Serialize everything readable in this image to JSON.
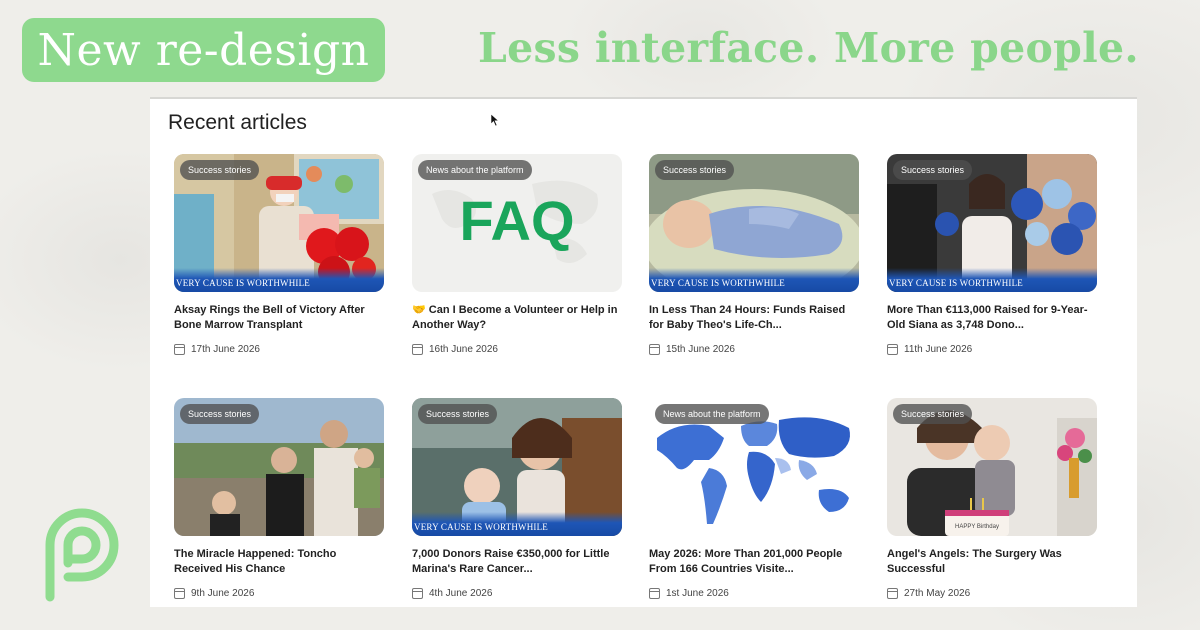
{
  "header": {
    "badge_label": "New re-design",
    "tagline": "Less interface. More people."
  },
  "panel": {
    "title": "Recent articles"
  },
  "colors": {
    "accent_green": "#8ed98e",
    "banner_blue": "#1e56b6"
  },
  "banner_text": "VERY CAUSE IS WORTHWHILE",
  "articles": [
    {
      "category": "Success stories",
      "title": "Aksay Rings the Bell of Victory After Bone Marrow Transplant",
      "date": "17th June 2026",
      "banner": true
    },
    {
      "category": "News about the platform",
      "title": "🤝 Can I Become a Volunteer or Help in Another Way?",
      "date": "16th June 2026",
      "thumb_text": "FAQ",
      "banner": false
    },
    {
      "category": "Success stories",
      "title": "In Less Than 24 Hours: Funds Raised for Baby Theo's Life-Ch...",
      "date": "15th June 2026",
      "banner": true
    },
    {
      "category": "Success stories",
      "title": "More Than €113,000 Raised for 9-Year-Old Siana as 3,748 Dono...",
      "date": "11th June 2026",
      "banner": true
    },
    {
      "category": "Success stories",
      "title": "The Miracle Happened: Toncho Received His Chance",
      "date": "9th June 2026",
      "banner": false
    },
    {
      "category": "Success stories",
      "title": "7,000 Donors Raise €350,000 for Little Marina's Rare Cancer...",
      "date": "4th June 2026",
      "banner": true
    },
    {
      "category": "News about the platform",
      "title": "May 2026: More Than 201,000 People From 166 Countries Visite...",
      "date": "1st June 2026",
      "banner": false
    },
    {
      "category": "Success stories",
      "title": "Angel's Angels: The Surgery Was Successful",
      "date": "27th May 2026",
      "cake_text": "HAPPY Birthday",
      "banner": false
    }
  ]
}
